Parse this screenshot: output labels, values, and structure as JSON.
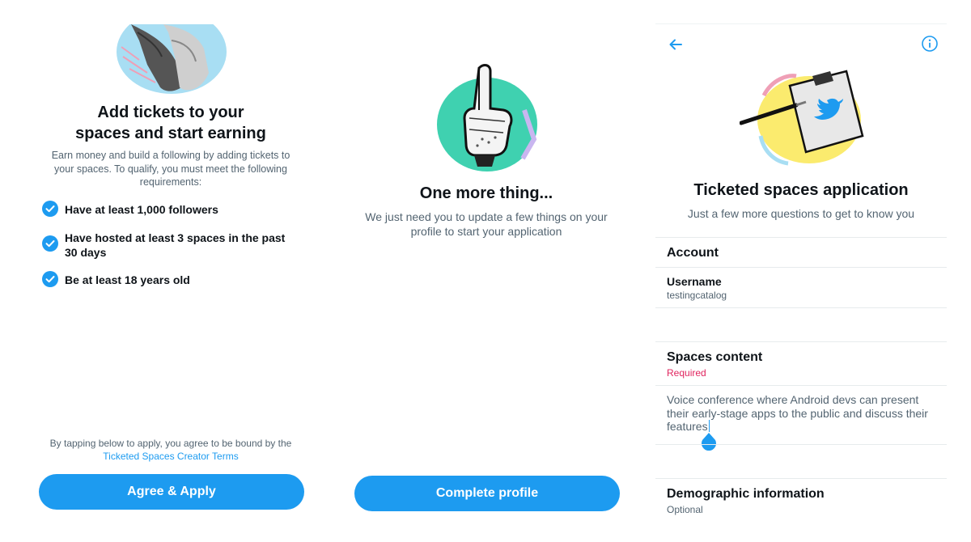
{
  "panel1": {
    "title_line1": "Add tickets to your",
    "title_line2": "spaces and start earning",
    "description": "Earn money and build a following by adding tickets to your spaces. To qualify, you must meet the following requirements:",
    "requirements": [
      "Have at least 1,000 followers",
      "Have hosted at least 3 spaces in the past 30 days",
      "Be at least 18 years old"
    ],
    "terms_text": "By tapping below to apply, you agree to be bound by the",
    "terms_link": "Ticketed Spaces Creator Terms",
    "button_label": "Agree & Apply"
  },
  "panel2": {
    "title": "One more thing...",
    "description": "We just need you to update a few things on your profile to start your application",
    "button_label": "Complete profile"
  },
  "panel3": {
    "title": "Ticketed spaces application",
    "subtitle": "Just a few more questions to get to know you",
    "account": {
      "heading": "Account",
      "username_label": "Username",
      "username_value": "testingcatalog"
    },
    "spaces_content": {
      "heading": "Spaces content",
      "required_label": "Required",
      "value": "Voice conference where Android devs can present their early-stage apps to the public and discuss their features"
    },
    "demographic": {
      "heading": "Demographic information",
      "optional_label": "Optional"
    }
  },
  "icons": {
    "back": "arrow-left-icon",
    "info": "info-icon",
    "check": "check-circle-icon"
  },
  "colors": {
    "accent": "#1d9bf0",
    "required": "#e0245e",
    "text_primary": "#0f1419",
    "text_secondary": "#536471",
    "illustration_teal": "#3fd1b0",
    "illustration_yellow": "#fbeb6e",
    "illustration_lightblue": "#a8def3"
  }
}
